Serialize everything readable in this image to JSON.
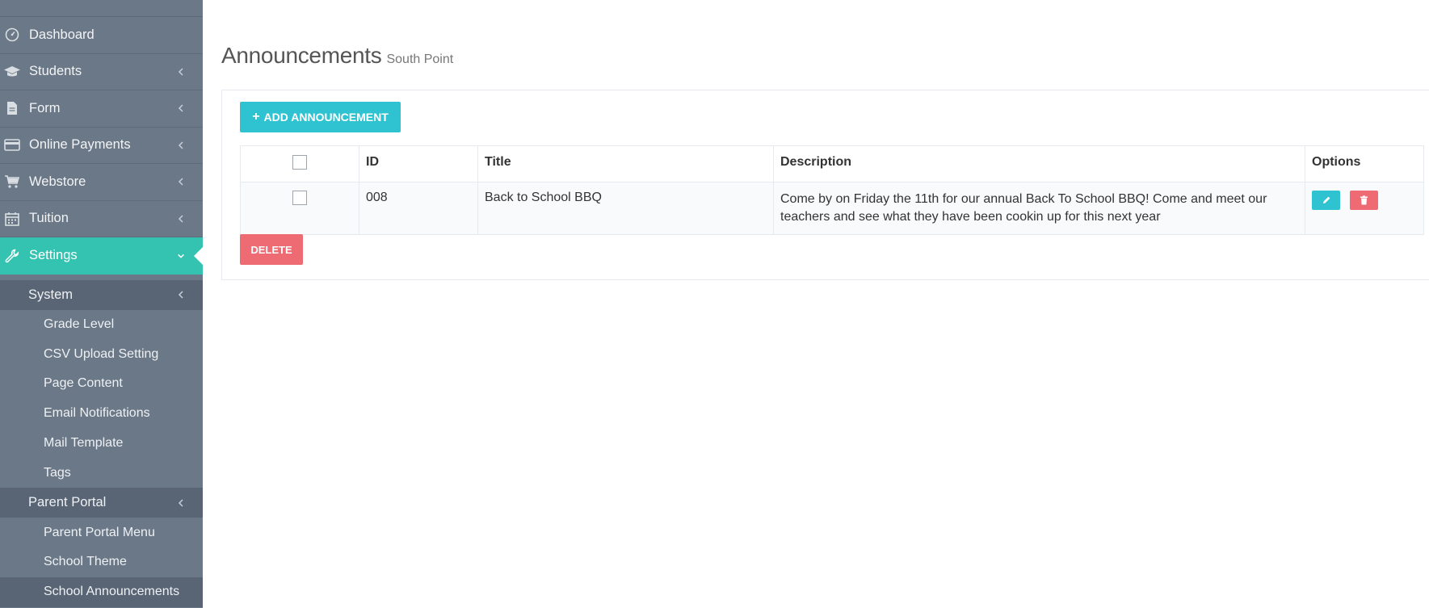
{
  "sidebar": {
    "items": [
      {
        "label": "Dashboard",
        "icon": "dashboard-icon"
      },
      {
        "label": "Students",
        "icon": "graduation-cap-icon"
      },
      {
        "label": "Form",
        "icon": "document-icon"
      },
      {
        "label": "Online Payments",
        "icon": "credit-card-icon"
      },
      {
        "label": "Webstore",
        "icon": "cart-icon"
      },
      {
        "label": "Tuition",
        "icon": "calendar-icon"
      },
      {
        "label": "Settings",
        "icon": "wrench-icon"
      }
    ],
    "system": {
      "label": "System",
      "items": [
        "Grade Level",
        "CSV Upload Setting",
        "Page Content",
        "Email Notifications",
        "Mail Template",
        "Tags"
      ]
    },
    "parent_portal": {
      "label": "Parent Portal",
      "items": [
        "Parent Portal Menu",
        "School Theme",
        "School Announcements"
      ]
    },
    "colors": {
      "active": "#33c3b0",
      "background": "#6b7887",
      "submenu": "#596574"
    }
  },
  "page": {
    "title": "Announcements",
    "subtitle": "South Point"
  },
  "toolbar": {
    "add_label": "ADD ANNOUNCEMENT",
    "delete_label": "DELETE"
  },
  "table": {
    "headers": [
      "ID",
      "Title",
      "Description",
      "Options"
    ],
    "rows": [
      {
        "id": "008",
        "title": "Back to School BBQ",
        "description": "Come by on Friday the 11th for our annual Back To School BBQ! Come and meet our teachers and see what they have been cookin up for this next year"
      }
    ]
  },
  "colors": {
    "accent": "#2fc3d2",
    "danger": "#ef6b73"
  }
}
